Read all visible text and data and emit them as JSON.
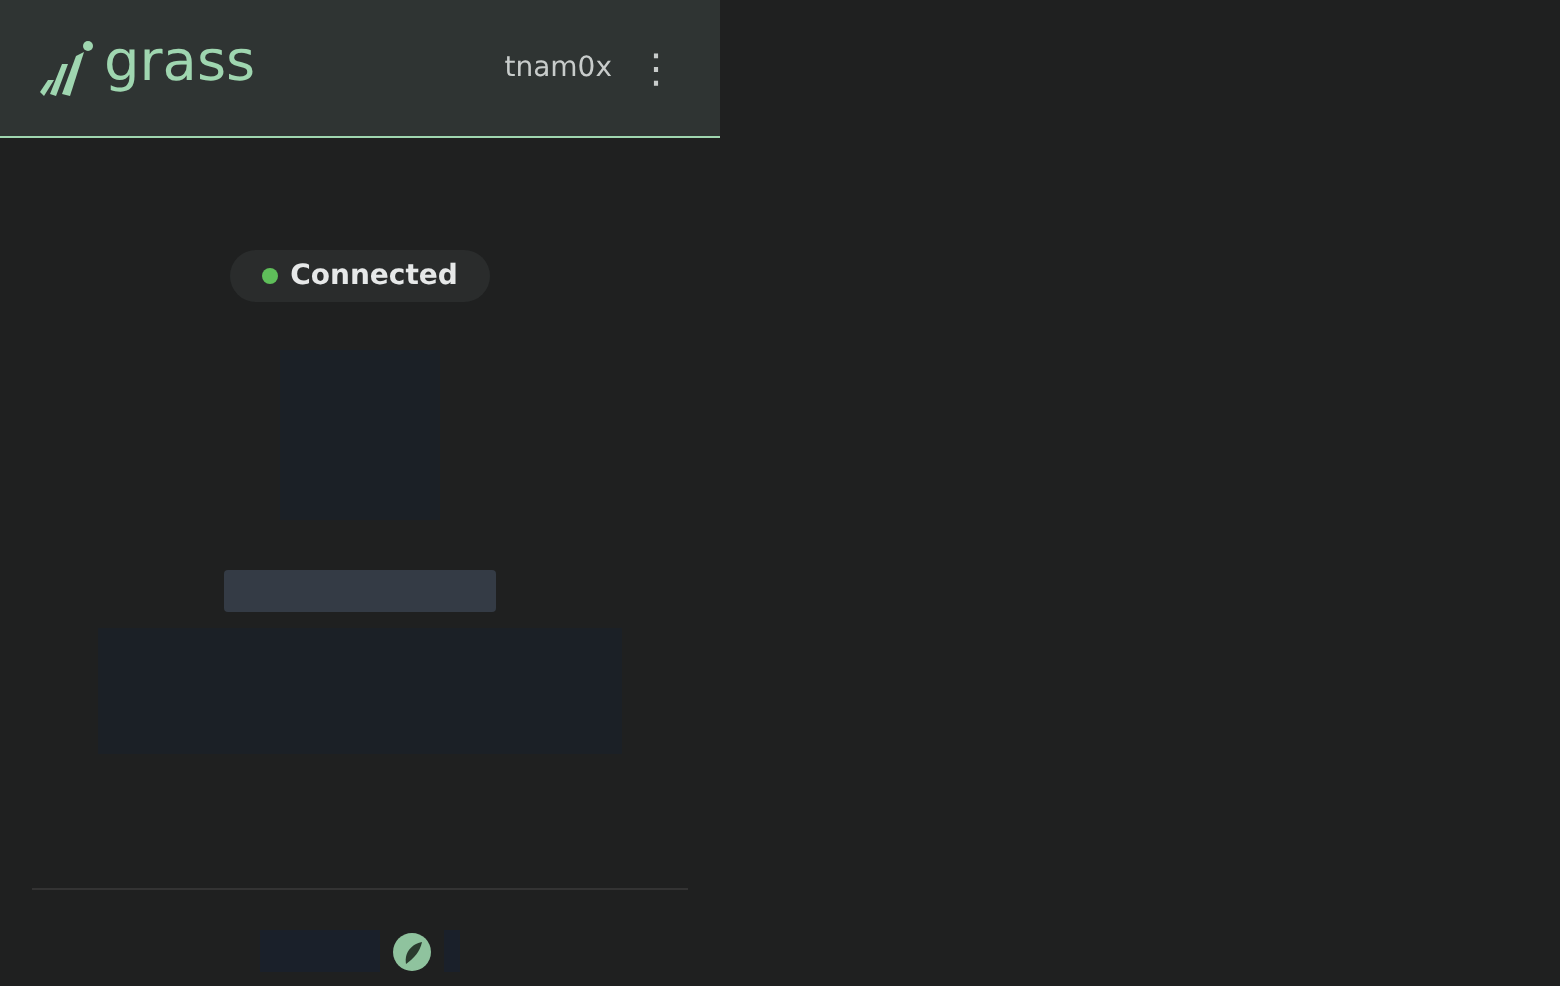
{
  "header": {
    "logo": "grass",
    "username": "tnam0x",
    "menu_glyph": "⋮"
  },
  "status": {
    "label": "Connected",
    "connected": true
  }
}
